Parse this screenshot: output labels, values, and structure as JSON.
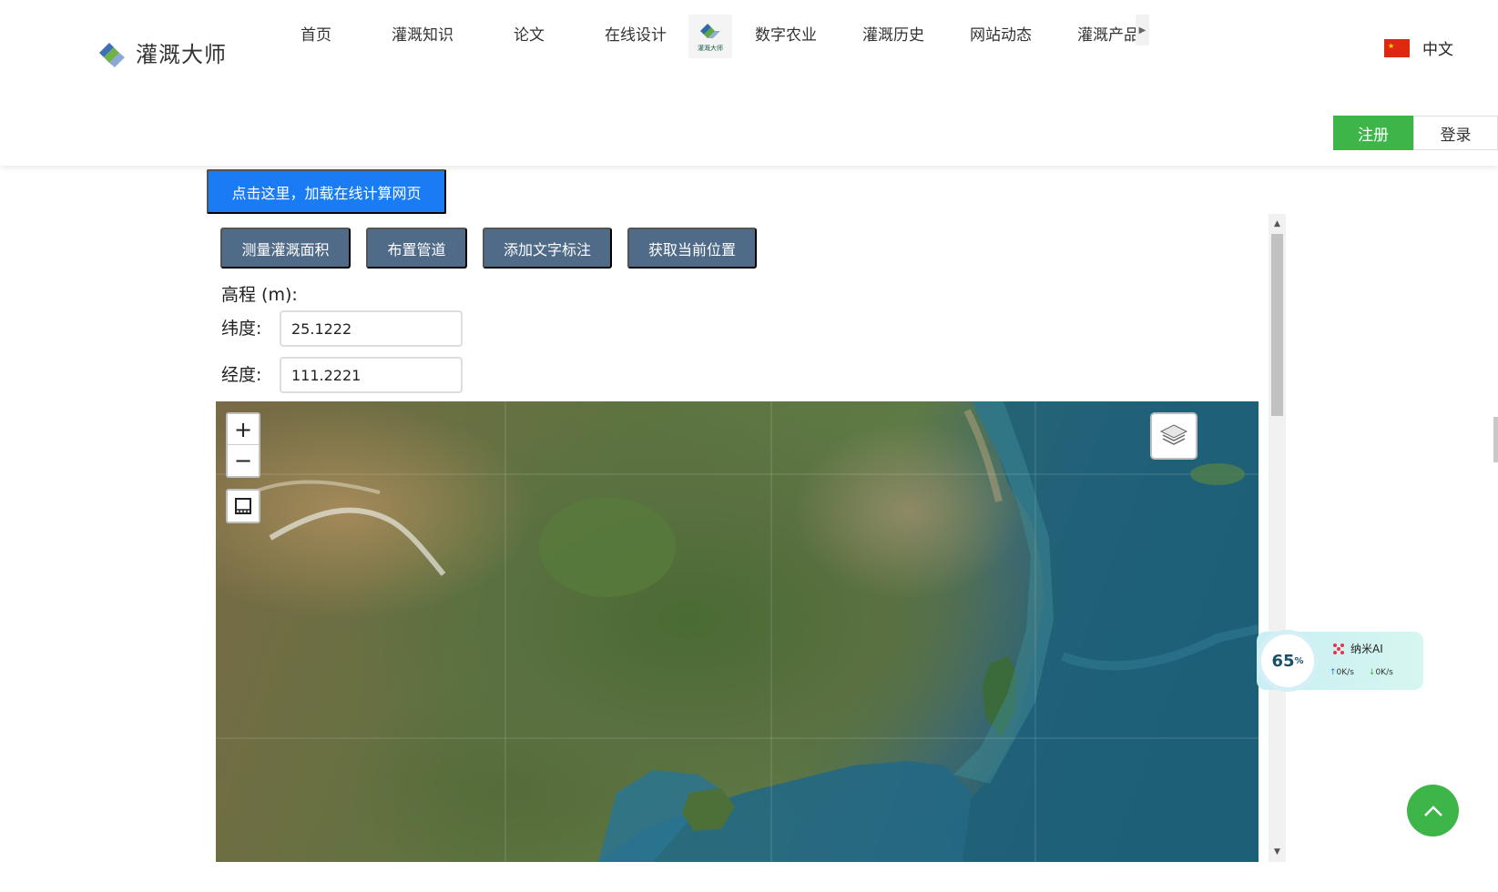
{
  "site": {
    "name": "灌溉大师"
  },
  "nav": {
    "items": [
      {
        "label": "首页"
      },
      {
        "label": "灌溉知识"
      },
      {
        "label": "论文"
      },
      {
        "label": "在线设计"
      },
      {
        "label": "数字农业"
      },
      {
        "label": "灌溉历史"
      },
      {
        "label": "网站动态"
      },
      {
        "label": "灌溉产品"
      }
    ],
    "badge_text": "灌溉大师"
  },
  "lang": {
    "label": "中文"
  },
  "auth": {
    "register": "注册",
    "login": "登录"
  },
  "load_button": "点击这里，加载在线计算网页",
  "toolbar": {
    "measure": "测量灌溉面积",
    "pipe": "布置管道",
    "text": "添加文字标注",
    "locate": "获取当前位置"
  },
  "form": {
    "elevation_label": "高程 (m):",
    "lat_label": "纬度:",
    "lat_value": "25.1222",
    "lon_label": "经度:",
    "lon_value": "111.2221"
  },
  "map": {
    "zoom_in": "+",
    "zoom_out": "−"
  },
  "widget": {
    "percent": "65",
    "percent_unit": "%",
    "name": "纳米AI",
    "up": "0K/s",
    "down": "0K/s"
  },
  "colors": {
    "primary_blue": "#1a7cf5",
    "green": "#3db549",
    "tool_button": "#506b88"
  }
}
